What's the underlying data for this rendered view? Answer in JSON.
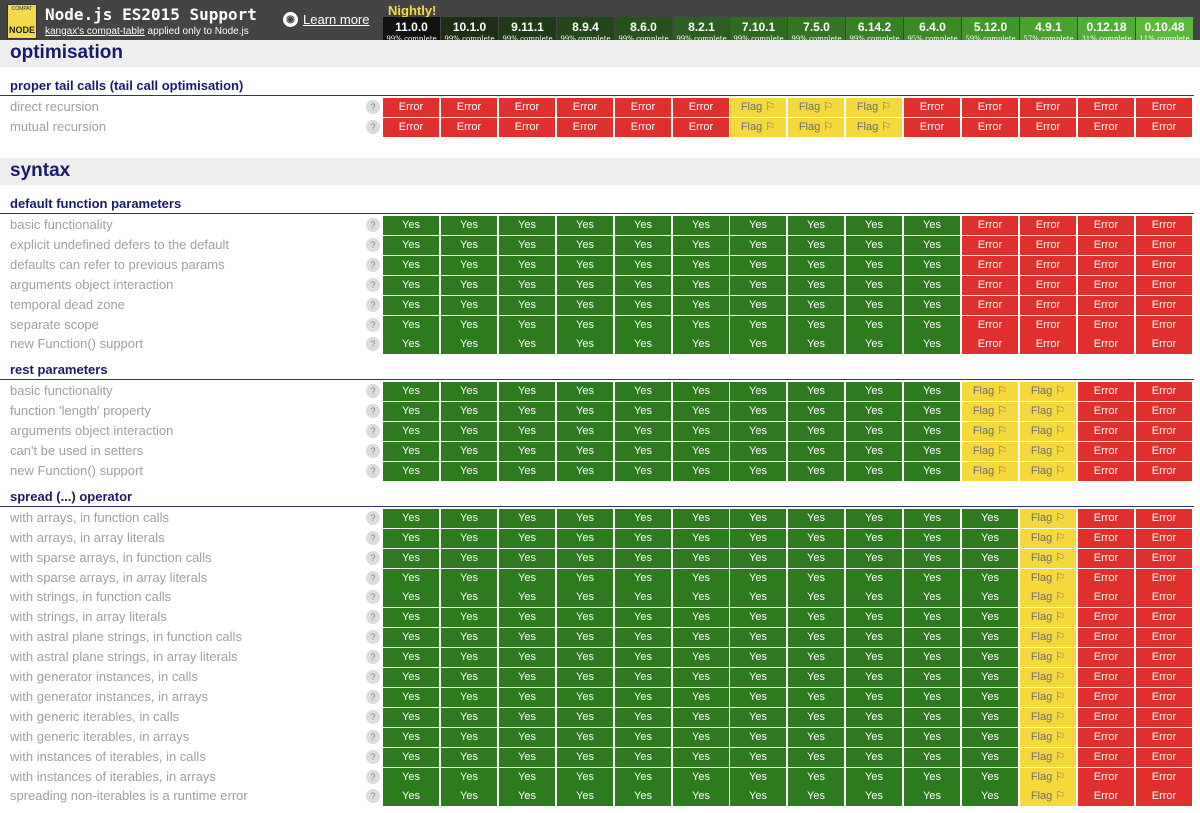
{
  "header": {
    "logo": {
      "top_text": "COMPAT",
      "main_text": "NODE"
    },
    "title": "Node.js ES2015 Support",
    "subtitle_link": "kangax's compat-table",
    "subtitle_rest": " applied only to Node.js",
    "learn_more": "Learn more",
    "github_icon": "github-icon",
    "nightly": "Nightly!"
  },
  "columns": [
    {
      "version": "11.0.0",
      "complete": "99% complete",
      "color": "#111111"
    },
    {
      "version": "10.1.0",
      "complete": "99% complete",
      "color": "#1c2e14"
    },
    {
      "version": "9.11.1",
      "complete": "99% complete",
      "color": "#1f3a16"
    },
    {
      "version": "8.9.4",
      "complete": "99% complete",
      "color": "#23461a"
    },
    {
      "version": "8.6.0",
      "complete": "99% complete",
      "color": "#27521c"
    },
    {
      "version": "8.2.1",
      "complete": "99% complete",
      "color": "#2b5e1f"
    },
    {
      "version": "7.10.1",
      "complete": "99% complete",
      "color": "#2f6a21"
    },
    {
      "version": "7.5.0",
      "complete": "99% complete",
      "color": "#337523"
    },
    {
      "version": "6.14.2",
      "complete": "99% complete",
      "color": "#378025"
    },
    {
      "version": "6.4.0",
      "complete": "95% complete",
      "color": "#3b8a27"
    },
    {
      "version": "5.12.0",
      "complete": "59% complete",
      "color": "#42962b"
    },
    {
      "version": "4.9.1",
      "complete": "57% complete",
      "color": "#49a230"
    },
    {
      "version": "0.12.18",
      "complete": "31% complete",
      "color": "#51ad35"
    },
    {
      "version": "0.10.48",
      "complete": "11% complete",
      "color": "#5ab83a"
    }
  ],
  "labels": {
    "yes": "Yes",
    "error": "Error",
    "flag": "Flag ⚐",
    "help": "?"
  },
  "colors": {
    "yes": "#2d7a1f",
    "error": "#e0302e",
    "flag": "#f4d83c",
    "section_title": "#1a1a6c"
  },
  "sections": [
    {
      "title": "optimisation",
      "groups": [
        {
          "title": "proper tail calls (tail call optimisation)",
          "rows": [
            {
              "label": "direct recursion",
              "pattern": "EEEEEEFFFEEEEE"
            },
            {
              "label": "mutual recursion",
              "pattern": "EEEEEEFFFEEEEE"
            }
          ]
        }
      ]
    },
    {
      "title": "syntax",
      "groups": [
        {
          "title": "default function parameters",
          "rows": [
            {
              "label": "basic functionality",
              "pattern": "YYYYYYYYYYEEEE"
            },
            {
              "label": "explicit undefined defers to the default",
              "pattern": "YYYYYYYYYYEEEE"
            },
            {
              "label": "defaults can refer to previous params",
              "pattern": "YYYYYYYYYYEEEE"
            },
            {
              "label": "arguments object interaction",
              "pattern": "YYYYYYYYYYEEEE"
            },
            {
              "label": "temporal dead zone",
              "pattern": "YYYYYYYYYYEEEE"
            },
            {
              "label": "separate scope",
              "pattern": "YYYYYYYYYYEEEE"
            },
            {
              "label": "new Function() support",
              "pattern": "YYYYYYYYYYEEEE"
            }
          ]
        },
        {
          "title": "rest parameters",
          "rows": [
            {
              "label": "basic functionality",
              "pattern": "YYYYYYYYYYFFEE"
            },
            {
              "label": "function 'length' property",
              "pattern": "YYYYYYYYYYFFEE"
            },
            {
              "label": "arguments object interaction",
              "pattern": "YYYYYYYYYYFFEE"
            },
            {
              "label": "can't be used in setters",
              "pattern": "YYYYYYYYYYFFEE"
            },
            {
              "label": "new Function() support",
              "pattern": "YYYYYYYYYYFFEE"
            }
          ]
        },
        {
          "title": "spread (...) operator",
          "rows": [
            {
              "label": "with arrays, in function calls",
              "pattern": "YYYYYYYYYYYFEE"
            },
            {
              "label": "with arrays, in array literals",
              "pattern": "YYYYYYYYYYYFEE"
            },
            {
              "label": "with sparse arrays, in function calls",
              "pattern": "YYYYYYYYYYYFEE"
            },
            {
              "label": "with sparse arrays, in array literals",
              "pattern": "YYYYYYYYYYYFEE"
            },
            {
              "label": "with strings, in function calls",
              "pattern": "YYYYYYYYYYYFEE"
            },
            {
              "label": "with strings, in array literals",
              "pattern": "YYYYYYYYYYYFEE"
            },
            {
              "label": "with astral plane strings, in function calls",
              "pattern": "YYYYYYYYYYYFEE"
            },
            {
              "label": "with astral plane strings, in array literals",
              "pattern": "YYYYYYYYYYYFEE"
            },
            {
              "label": "with generator instances, in calls",
              "pattern": "YYYYYYYYYYYFEE"
            },
            {
              "label": "with generator instances, in arrays",
              "pattern": "YYYYYYYYYYYFEE"
            },
            {
              "label": "with generic iterables, in calls",
              "pattern": "YYYYYYYYYYYFEE"
            },
            {
              "label": "with generic iterables, in arrays",
              "pattern": "YYYYYYYYYYYFEE"
            },
            {
              "label": "with instances of iterables, in calls",
              "pattern": "YYYYYYYYYYYFEE"
            },
            {
              "label": "with instances of iterables, in arrays",
              "pattern": "YYYYYYYYYYYFEE"
            },
            {
              "label": "spreading non-iterables is a runtime error",
              "pattern": "YYYYYYYYYYYFEE"
            }
          ]
        }
      ]
    }
  ]
}
